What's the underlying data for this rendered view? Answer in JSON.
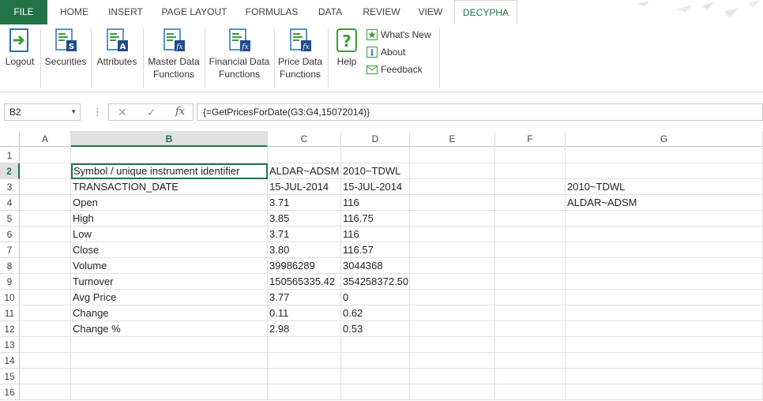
{
  "ribbon_tabs": [
    "FILE",
    "HOME",
    "INSERT",
    "PAGE LAYOUT",
    "FORMULAS",
    "DATA",
    "REVIEW",
    "VIEW",
    "DECYPHA"
  ],
  "active_tab": "DECYPHA",
  "accent_color": "#217346",
  "ribbon_buttons": {
    "logout": "Logout",
    "securities": "Securities",
    "attributes": "Attributes",
    "master_data_1": "Master Data",
    "master_data_2": "Functions",
    "financial_data_1": "Financial Data",
    "financial_data_2": "Functions",
    "price_data_1": "Price Data",
    "price_data_2": "Functions",
    "help": "Help",
    "whats_new": "What's New",
    "about": "About",
    "feedback": "Feedback"
  },
  "formula_bar": {
    "name_box": "B2",
    "formula": "{=GetPricesForDate(G3:G4,15072014)}",
    "fx": "fx"
  },
  "columns": [
    "A",
    "B",
    "C",
    "D",
    "E",
    "F",
    "G"
  ],
  "rows": [
    "1",
    "2",
    "3",
    "4",
    "5",
    "6",
    "7",
    "8",
    "9",
    "10",
    "11",
    "12",
    "13",
    "14",
    "15",
    "16"
  ],
  "cells": {
    "B2": "Symbol / unique instrument identifier",
    "C2": "ALDAR~ADSM",
    "D2": "2010~TDWL",
    "B3": "TRANSACTION_DATE",
    "C3": "15-JUL-2014",
    "D3": "15-JUL-2014",
    "G3": "2010~TDWL",
    "B4": "Open",
    "C4": "3.71",
    "D4": "116",
    "G4": "ALDAR~ADSM",
    "B5": "High",
    "C5": "3.85",
    "D5": "116.75",
    "B6": "Low",
    "C6": "3.71",
    "D6": "116",
    "B7": "Close",
    "C7": "3.80",
    "D7": "116.57",
    "B8": "Volume",
    "C8": "39986289",
    "D8": "3044368",
    "B9": "Turnover",
    "C9": "150565335.42",
    "D9": "354258372.50",
    "B10": "Avg Price",
    "C10": "3.77",
    "D10": "0",
    "B11": "Change",
    "C11": "0.11",
    "D11": "0.62",
    "B12": "Change %",
    "C12": "2.98",
    "D12": "0.53"
  }
}
